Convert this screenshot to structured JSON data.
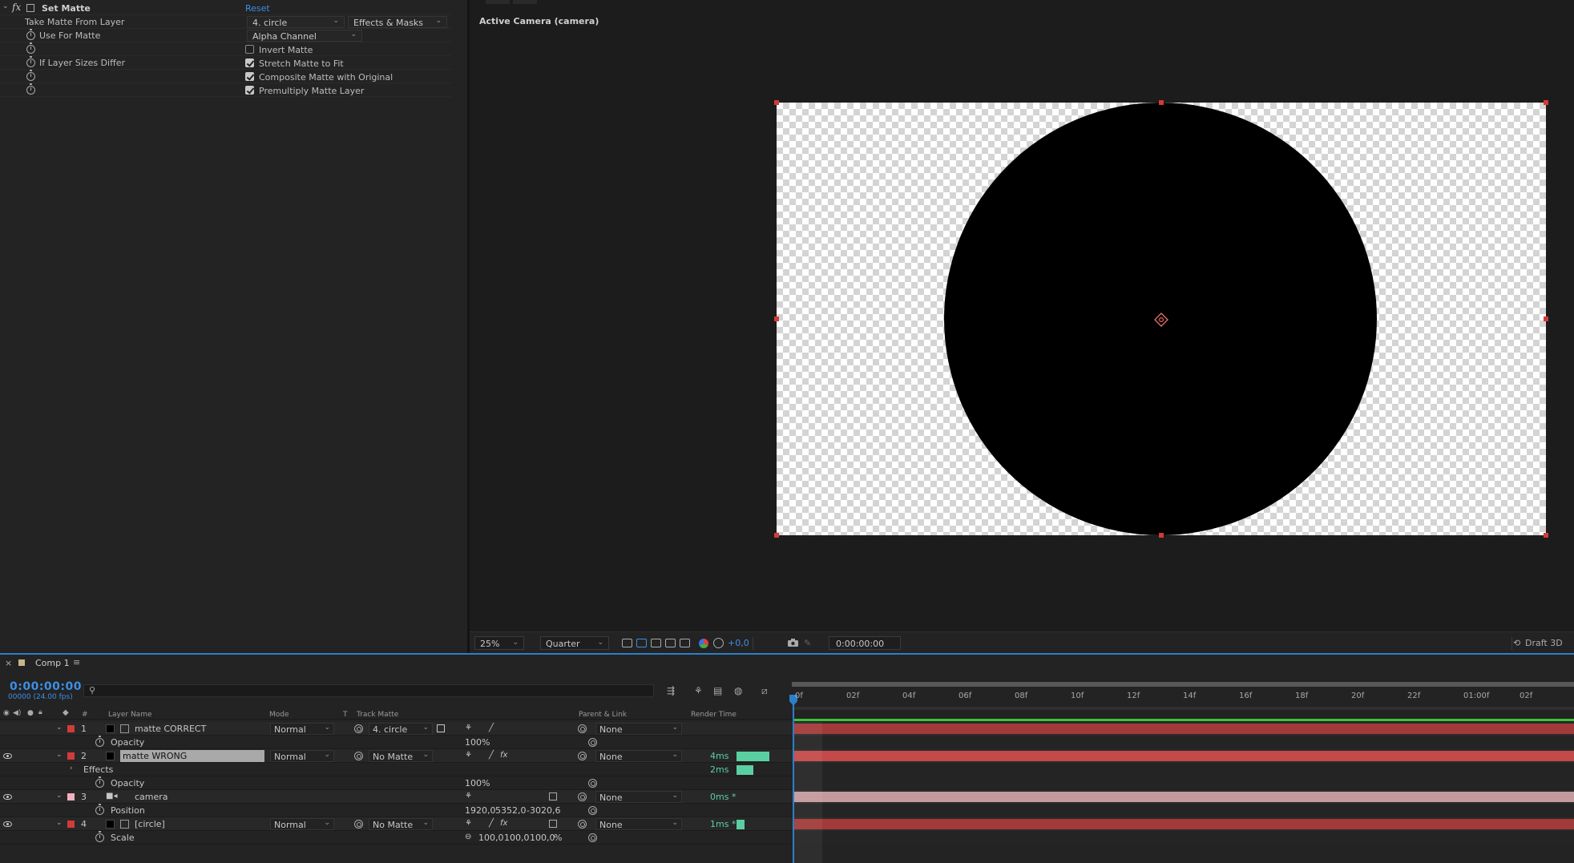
{
  "effect_controls": {
    "fx_symbol": "fx",
    "effect_name": "Set Matte",
    "reset_label": "Reset",
    "take_matte_from_layer": {
      "label": "Take Matte From Layer",
      "value": "4. circle",
      "source": "Effects & Masks"
    },
    "use_for_matte": {
      "label": "Use For Matte",
      "value": "Alpha Channel"
    },
    "invert_matte": {
      "label": "Invert Matte",
      "checked": false
    },
    "if_layer_sizes_differ": {
      "label": "If Layer Sizes Differ"
    },
    "stretch_matte": {
      "label": "Stretch Matte to Fit",
      "checked": true
    },
    "composite_matte": {
      "label": "Composite Matte with Original",
      "checked": true
    },
    "premultiply": {
      "label": "Premultiply Matte Layer",
      "checked": true
    }
  },
  "viewer": {
    "title": "Active Camera (camera)",
    "zoom": "25%",
    "resolution": "Quarter",
    "exposure": "+0,0",
    "timecode": "0:00:00:00",
    "renderer": "Draft 3D",
    "canvas_background": "transparent-checkerboard",
    "shape_color": "#000000",
    "handle_color": "#d23b3b"
  },
  "timeline": {
    "close_symbol": "×",
    "comp_name": "Comp 1",
    "menu_symbol": "≡",
    "current_time": "0:00:00:00",
    "fps_label": "00000 (24.00 fps)",
    "columns": {
      "hash": "#",
      "layer_name": "Layer Name",
      "mode": "Mode",
      "t": "T",
      "track_matte": "Track Matte",
      "parent_link": "Parent & Link",
      "render_time": "Render Time"
    },
    "ruler_ticks": [
      "0f",
      "02f",
      "04f",
      "06f",
      "08f",
      "10f",
      "12f",
      "14f",
      "16f",
      "18f",
      "20f",
      "22f",
      "01:00f",
      "02f"
    ],
    "rows": {
      "l1": {
        "num": "1",
        "name": "matte CORRECT",
        "mode": "Normal",
        "matte": "4. circle",
        "parent": "None",
        "label_color": "#d23b3b"
      },
      "l1_opacity": {
        "name": "Opacity",
        "value": "100",
        "unit": "%"
      },
      "l2": {
        "num": "2",
        "name": "matte WRONG",
        "mode": "Normal",
        "matte": "No Matte",
        "parent": "None",
        "render_time": "4ms",
        "label_color": "#d23b3b"
      },
      "l2_effects": {
        "name": "Effects",
        "render_time": "2ms"
      },
      "l2_opacity": {
        "name": "Opacity",
        "value": "100",
        "unit": "%"
      },
      "l3": {
        "num": "3",
        "name": "camera",
        "parent": "None",
        "render_time": "0ms *",
        "label_color": "#f0b0c0"
      },
      "l3_position": {
        "name": "Position",
        "x": "1920,0",
        "y": "5352,0",
        "z": "-3020,6"
      },
      "l4": {
        "num": "4",
        "name": "[circle]",
        "mode": "Normal",
        "matte": "No Matte",
        "parent": "None",
        "render_time": "1ms *",
        "label_color": "#d23b3b"
      },
      "l4_scale": {
        "name": "Scale",
        "x": "100,0",
        "y": "100,0",
        "z": "100,0",
        "unit": "%"
      }
    },
    "render_bars": {
      "l2": 0.9,
      "l2_effects": 0.45,
      "l4": 0.22
    },
    "bar_colors": {
      "l1": "#a33a3a",
      "l2": "#c44a4a",
      "l3": "#c49a9e",
      "l4": "#a33a3a"
    }
  }
}
